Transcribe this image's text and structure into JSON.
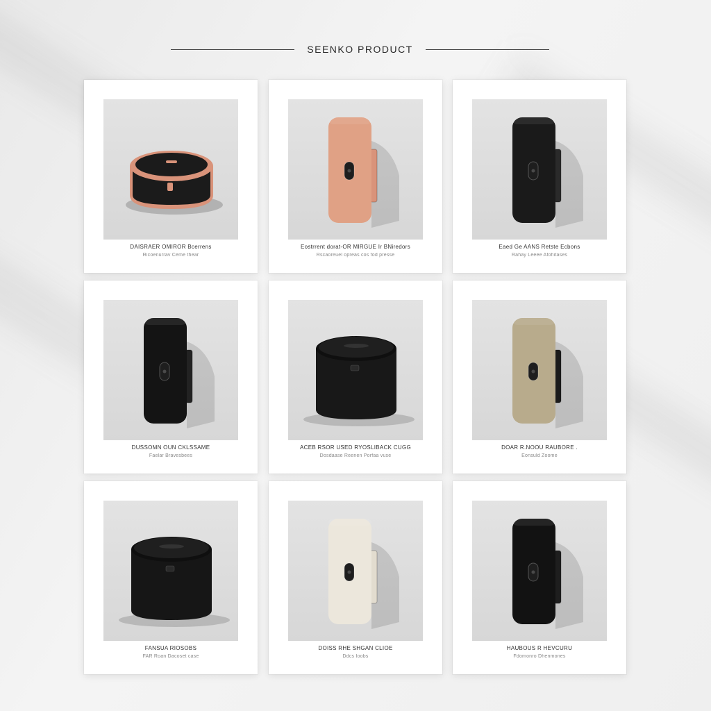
{
  "header": {
    "title": "SEENKO PRODUCT"
  },
  "cards": [
    {
      "name": "DAISRAER OMIROR Bcerrens",
      "sub": "Ricoenurrav Ceme thear",
      "product": "round-speaker",
      "body_color": "#1b1b1b",
      "accent_color": "#d9937a"
    },
    {
      "name": "Eostrrent dorat-OR MIRGUE Ir BNiredors",
      "sub": "Rscaoreuel opreas cos fod presse",
      "product": "tall-speaker",
      "body_color": "#e0a185",
      "accent_color": "#d9937a"
    },
    {
      "name": "Eaed Ge AANS Retste Ecbons",
      "sub": "Rahay Leeee Afohitases",
      "product": "tall-speaker",
      "body_color": "#1a1a1a",
      "accent_color": "#2a2a2a"
    },
    {
      "name": "DUSSOMN OUN CKLSSAME",
      "sub": "Faelar Bravesbees",
      "product": "tall-speaker",
      "body_color": "#141414",
      "accent_color": "#222222"
    },
    {
      "name": "ACEB RSOR USED RYOSLIBACK CUGG",
      "sub": "Dosdaase Reenen Porfaa vuse",
      "product": "drum-speaker",
      "body_color": "#181818",
      "accent_color": "#222222"
    },
    {
      "name": "DOAR R.NOOU RAUBORE .",
      "sub": "Eonsuld Zoome",
      "product": "tall-speaker",
      "body_color": "#b8ab8c",
      "accent_color": "#1b1b1b"
    },
    {
      "name": "FANSUA RIOSOBS",
      "sub": "FAR Roan Dacoset case",
      "product": "drum-speaker",
      "body_color": "#161616",
      "accent_color": "#222222"
    },
    {
      "name": "DOISS RHE SHGAN CLIOE",
      "sub": "Ddcs Ioobs",
      "product": "tall-speaker",
      "body_color": "#ece7dc",
      "accent_color": "#e2dccf"
    },
    {
      "name": "HAUBOUS R HEVCURU",
      "sub": "Fdomonro Dhenmones",
      "product": "tall-speaker",
      "body_color": "#121212",
      "accent_color": "#1e1e1e"
    }
  ]
}
